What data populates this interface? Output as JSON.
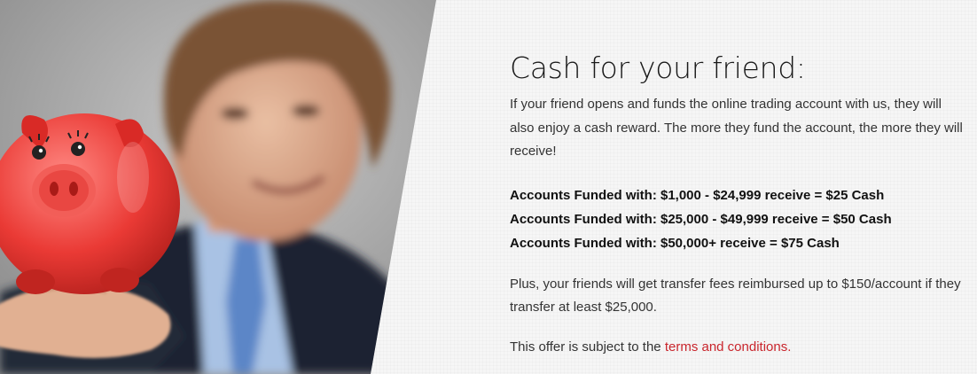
{
  "hero": {
    "image_description_icon": "piggy-bank-icon"
  },
  "content": {
    "title": "Cash for your friend:",
    "intro": "If your friend opens and funds the online trading account with us, they will also enjoy a cash reward. The more they fund the account, the more they will receive!",
    "tiers": [
      "Accounts Funded with: $1,000 - $24,999 receive = $25 Cash",
      "Accounts Funded with: $25,000 - $49,999 receive = $50 Cash",
      "Accounts Funded with: $50,000+ receive = $75 Cash"
    ],
    "transfer_note": "Plus, your friends will get transfer fees reimbursed up to $150/account if they transfer at least $25,000.",
    "offer_prefix": "This offer is subject to the ",
    "terms_link": "terms and conditions.",
    "link_color": "#c9252c"
  }
}
